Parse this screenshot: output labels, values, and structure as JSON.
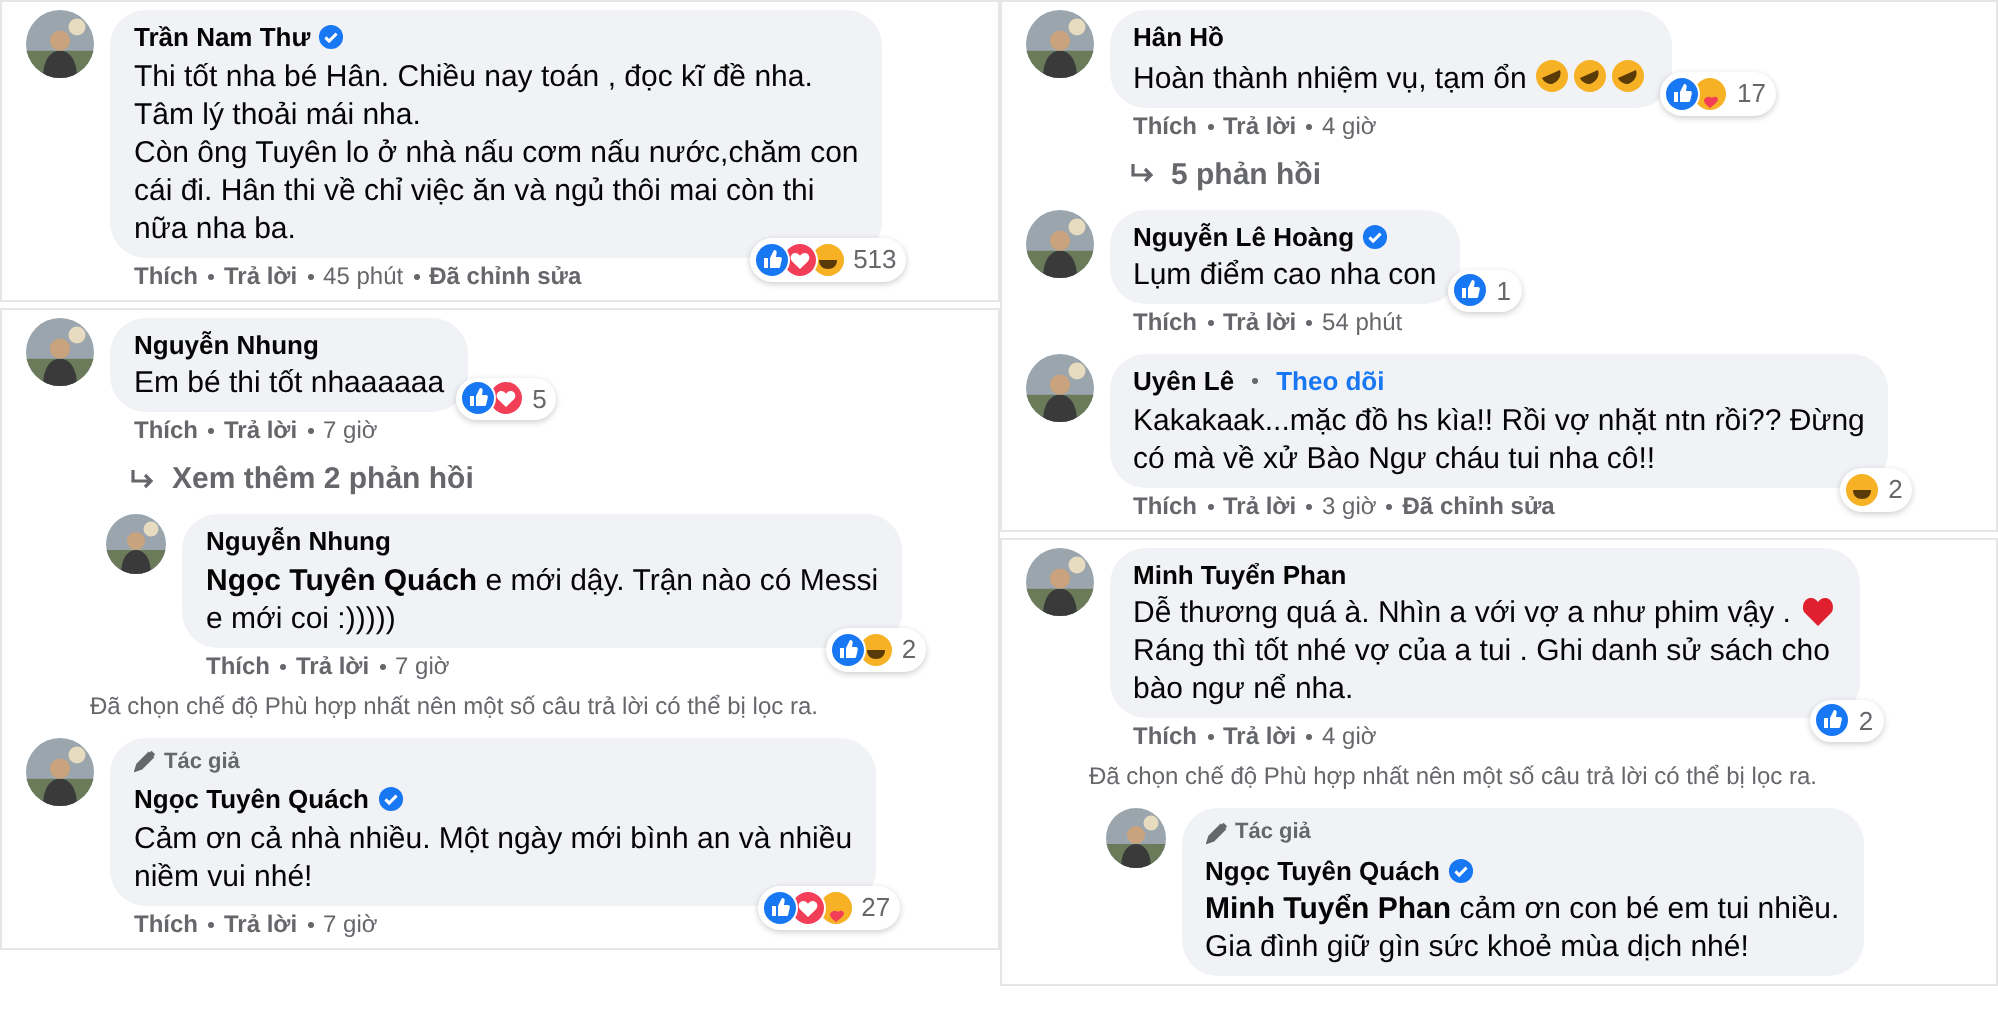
{
  "columns": [
    {
      "panels": [
        {
          "items": [
            {
              "kind": "comment",
              "author": "Trần Nam Thư",
              "verified": true,
              "text": "Thi tốt nha bé Hân. Chiều nay toán , đọc kĩ đề nha.\nTâm lý thoải mái nha.\nCòn ông Tuyên lo ở nhà nấu cơm nấu nước,chăm con\ncái đi. Hân thi về chỉ việc ăn và ngủ thôi mai còn thi\nnữa nha ba.",
              "reactions": {
                "icons": [
                  {
                    "kind": "like"
                  },
                  {
                    "kind": "love"
                  },
                  {
                    "kind": "haha"
                  }
                ],
                "count": "513"
              },
              "actions": [
                "Thích",
                "Trả lời"
              ],
              "time": "45 phút",
              "edited": "Đã chỉnh sửa"
            }
          ]
        },
        {
          "items": [
            {
              "kind": "comment",
              "author": "Nguyễn Nhung",
              "text": "Em bé thi tốt nhaaaaaa",
              "reactions": {
                "icons": [
                  {
                    "kind": "like"
                  },
                  {
                    "kind": "love"
                  }
                ],
                "count": "5"
              },
              "actions": [
                "Thích",
                "Trả lời"
              ],
              "time": "7 giờ"
            },
            {
              "kind": "replies_link",
              "label": "Xem thêm 2 phản hồi"
            },
            {
              "kind": "comment",
              "reply": true,
              "author": "Nguyễn Nhung",
              "text": "**Ngọc Tuyên Quách** e mới dậy. Trận nào có Messi\ne mới coi :)))))",
              "reactions": {
                "icons": [
                  {
                    "kind": "like"
                  },
                  {
                    "kind": "haha"
                  }
                ],
                "count": "2"
              },
              "actions": [
                "Thích",
                "Trả lời"
              ],
              "time": "7 giờ"
            },
            {
              "kind": "notice",
              "text": "Đã chọn chế độ Phù hợp nhất nên một số câu trả lời có thể bị lọc ra."
            },
            {
              "kind": "comment",
              "badge": "Tác giả",
              "author": "Ngọc Tuyên Quách",
              "verified": true,
              "text": "Cảm ơn cả nhà nhiều. Một ngày mới bình an và nhiều\nniềm vui nhé!",
              "reactions": {
                "icons": [
                  {
                    "kind": "like"
                  },
                  {
                    "kind": "love"
                  },
                  {
                    "kind": "care"
                  }
                ],
                "count": "27"
              },
              "actions": [
                "Thích",
                "Trả lời"
              ],
              "time": "7 giờ"
            }
          ]
        }
      ]
    },
    {
      "panels": [
        {
          "items": [
            {
              "kind": "comment",
              "author": "Hân Hồ",
              "text": "Hoàn thành nhiệm vụ, tạm ổn",
              "trailing_emoji": [
                {
                  "kind": "rofl"
                },
                {
                  "kind": "rofl"
                },
                {
                  "kind": "rofl"
                }
              ],
              "reactions": {
                "icons": [
                  {
                    "kind": "like"
                  },
                  {
                    "kind": "care"
                  }
                ],
                "count": "17"
              },
              "actions": [
                "Thích",
                "Trả lời"
              ],
              "time": "4 giờ"
            },
            {
              "kind": "replies_link",
              "label": "5 phản hồi"
            },
            {
              "kind": "comment",
              "author": "Nguyễn Lê Hoàng",
              "verified": true,
              "text": "Lụm điểm cao nha con",
              "reactions": {
                "icons": [
                  {
                    "kind": "like"
                  }
                ],
                "count": "1"
              },
              "actions": [
                "Thích",
                "Trả lời"
              ],
              "time": "54 phút"
            },
            {
              "kind": "comment",
              "author": "Uyên Lê",
              "follow": "Theo dõi",
              "text": "Kakakaak...mặc đồ hs kìa!! Rồi vợ nhặt ntn rồi?? Đừng\ncó mà về xử Bào Ngư cháu tui nha cô!!",
              "reactions": {
                "icons": [
                  {
                    "kind": "haha"
                  }
                ],
                "count": "2"
              },
              "actions": [
                "Thích",
                "Trả lời"
              ],
              "time": "3 giờ",
              "edited": "Đã chỉnh sửa"
            }
          ]
        },
        {
          "items": [
            {
              "kind": "comment",
              "author": "Minh Tuyển Phan",
              "text": "Dễ thương quá à. Nhìn a với vợ a như phim vậy .",
              "trailing_emoji": [
                {
                  "kind": "heart"
                }
              ],
              "text_more": "Ráng thì tốt nhé vợ của a tui . Ghi danh sử sách cho\nbào ngư nể nha.",
              "reactions": {
                "icons": [
                  {
                    "kind": "like"
                  }
                ],
                "count": "2"
              },
              "actions": [
                "Thích",
                "Trả lời"
              ],
              "time": "4 giờ"
            },
            {
              "kind": "notice",
              "text": "Đã chọn chế độ Phù hợp nhất nên một số câu trả lời có thể bị lọc ra."
            },
            {
              "kind": "comment",
              "reply": true,
              "badge": "Tác giả",
              "author": "Ngọc Tuyên Quách",
              "verified": true,
              "text": "**Minh Tuyển Phan** cảm ơn con bé em tui nhiều.\nGia đình giữ gìn sức khoẻ mùa dịch nhé!"
            }
          ]
        }
      ]
    }
  ]
}
